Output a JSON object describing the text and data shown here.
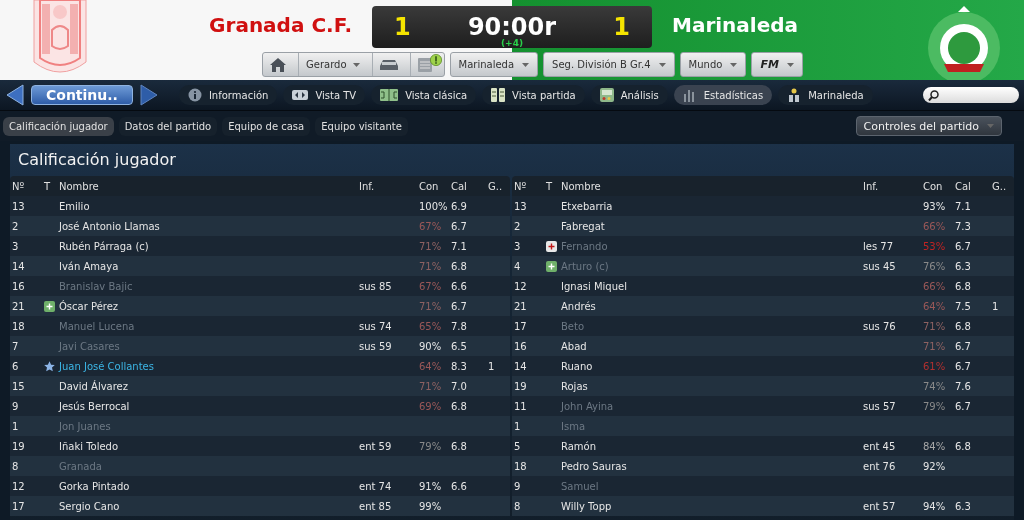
{
  "match": {
    "home": {
      "name": "Granada C.F.",
      "score": "1"
    },
    "away": {
      "name": "Marinaleda",
      "score": "1"
    },
    "clock": "90:00r",
    "added_time": "(+4)"
  },
  "toolbar": {
    "manager": "Gerardo",
    "alert": true,
    "dropdowns": [
      "Marinaleda",
      "Seg. División B Gr.4",
      "Mundo"
    ],
    "logo": "FM"
  },
  "nav": {
    "continue": "Continu..",
    "tabs": [
      {
        "label": "Información",
        "kind": "info",
        "selected": false
      },
      {
        "label": "Vista TV",
        "kind": "tv",
        "selected": false
      },
      {
        "label": "Vista clásica",
        "kind": "pitch",
        "selected": false
      },
      {
        "label": "Vista partida",
        "kind": "split",
        "selected": false
      },
      {
        "label": "Análisis",
        "kind": "analysis",
        "selected": false
      },
      {
        "label": "Estadísticas",
        "kind": "stats",
        "selected": true
      },
      {
        "label": "Marinaleda",
        "kind": "team",
        "selected": false
      }
    ]
  },
  "subtabs": [
    {
      "label": "Calificación jugador",
      "selected": true
    },
    {
      "label": "Datos del partido",
      "selected": false
    },
    {
      "label": "Equipo de casa",
      "selected": false
    },
    {
      "label": "Equipo visitante",
      "selected": false
    }
  ],
  "controls": "Controles del partido",
  "panel_title": "Calificación jugador",
  "tables": [
    {
      "columns": [
        "Nº",
        "T",
        "Nombre",
        "Inf.",
        "Con",
        "Cal",
        "G.."
      ],
      "rows": [
        {
          "no": "13",
          "name": "Emilio",
          "dimmed": false,
          "con": {
            "text": "100%",
            "color": "#e6e6e6"
          },
          "cal": "6.9"
        },
        {
          "no": "2",
          "name": "José Antonio Llamas",
          "dimmed": false,
          "con": {
            "text": "67%",
            "color": "#9a5858"
          },
          "cal": "6.7"
        },
        {
          "no": "3",
          "name": "Rubén Párraga (c)",
          "dimmed": false,
          "con": {
            "text": "71%",
            "color": "#8e6262"
          },
          "cal": "7.1"
        },
        {
          "no": "14",
          "name": "Iván Amaya",
          "dimmed": false,
          "con": {
            "text": "71%",
            "color": "#8e6262"
          },
          "cal": "6.8"
        },
        {
          "no": "16",
          "name": "Branislav Bajic",
          "dimmed": true,
          "inf": "sus 85",
          "con": {
            "text": "67%",
            "color": "#9a5858"
          },
          "cal": "6.6"
        },
        {
          "no": "21",
          "kind": "sub",
          "name": "Óscar Pérez",
          "dimmed": false,
          "con": {
            "text": "71%",
            "color": "#8e6262"
          },
          "cal": "6.7"
        },
        {
          "no": "18",
          "name": "Manuel Lucena",
          "dimmed": true,
          "inf": "sus 74",
          "con": {
            "text": "65%",
            "color": "#9a5858"
          },
          "cal": "7.8"
        },
        {
          "no": "7",
          "name": "Javi Casares",
          "dimmed": true,
          "inf": "sus 59",
          "con": {
            "text": "90%",
            "color": "#e6e6e6"
          },
          "cal": "6.5"
        },
        {
          "no": "6",
          "kind": "star",
          "name": "Juan José Collantes",
          "dimmed": false,
          "highlighted": true,
          "con": {
            "text": "64%",
            "color": "#9a5858"
          },
          "cal": "8.3",
          "goals": "1"
        },
        {
          "no": "15",
          "name": "David Álvarez",
          "dimmed": false,
          "con": {
            "text": "71%",
            "color": "#8e6262"
          },
          "cal": "7.0"
        },
        {
          "no": "9",
          "name": "Jesús Berrocal",
          "dimmed": false,
          "con": {
            "text": "69%",
            "color": "#9a5858"
          },
          "cal": "6.8"
        },
        {
          "no": "1",
          "name": "Jon Juanes",
          "dimmed": true
        },
        {
          "no": "19",
          "name": "Iñaki Toledo",
          "dimmed": false,
          "inf": "ent 59",
          "con": {
            "text": "79%",
            "color": "#8a8a8a"
          },
          "cal": "6.8"
        },
        {
          "no": "8",
          "name": "Granada",
          "dimmed": true
        },
        {
          "no": "12",
          "name": "Gorka Pintado",
          "dimmed": false,
          "inf": "ent 74",
          "con": {
            "text": "91%",
            "color": "#e6e6e6"
          },
          "cal": "6.6"
        },
        {
          "no": "17",
          "name": "Sergio Cano",
          "dimmed": false,
          "inf": "ent 85",
          "con": {
            "text": "99%",
            "color": "#e6e6e6"
          }
        }
      ]
    },
    {
      "columns": [
        "Nº",
        "T",
        "Nombre",
        "Inf.",
        "Con",
        "Cal",
        "G.."
      ],
      "rows": [
        {
          "no": "13",
          "name": "Etxebarria",
          "dimmed": false,
          "con": {
            "text": "93%",
            "color": "#e6e6e6"
          },
          "cal": "7.1"
        },
        {
          "no": "2",
          "name": "Fabregat",
          "dimmed": false,
          "con": {
            "text": "66%",
            "color": "#9a5858"
          },
          "cal": "7.3"
        },
        {
          "no": "3",
          "kind": "injury",
          "name": "Fernando",
          "dimmed": true,
          "inf": "les 77",
          "con": {
            "text": "53%",
            "color": "#c02424"
          },
          "cal": "6.7"
        },
        {
          "no": "4",
          "kind": "sub",
          "name": "Arturo (c)",
          "dimmed": true,
          "inf": "sus 45",
          "con": {
            "text": "76%",
            "color": "#8a8a8a"
          },
          "cal": "6.3"
        },
        {
          "no": "12",
          "name": "Ignasi Miquel",
          "dimmed": false,
          "con": {
            "text": "66%",
            "color": "#9a5858"
          },
          "cal": "6.8"
        },
        {
          "no": "21",
          "name": "Andrés",
          "dimmed": false,
          "con": {
            "text": "64%",
            "color": "#9a5858"
          },
          "cal": "7.5",
          "goals": "1"
        },
        {
          "no": "17",
          "name": "Beto",
          "dimmed": true,
          "inf": "sus 76",
          "con": {
            "text": "71%",
            "color": "#8e6262"
          },
          "cal": "6.8"
        },
        {
          "no": "16",
          "name": "Abad",
          "dimmed": false,
          "con": {
            "text": "71%",
            "color": "#8e6262"
          },
          "cal": "6.7"
        },
        {
          "no": "14",
          "name": "Ruano",
          "dimmed": false,
          "con": {
            "text": "61%",
            "color": "#b03030"
          },
          "cal": "6.7"
        },
        {
          "no": "19",
          "name": "Rojas",
          "dimmed": false,
          "con": {
            "text": "74%",
            "color": "#8a8a8a"
          },
          "cal": "7.6"
        },
        {
          "no": "11",
          "name": "John Ayina",
          "dimmed": true,
          "inf": "sus 57",
          "con": {
            "text": "79%",
            "color": "#8a8a8a"
          },
          "cal": "6.7"
        },
        {
          "no": "1",
          "name": "Isma",
          "dimmed": true
        },
        {
          "no": "5",
          "name": "Ramón",
          "dimmed": false,
          "inf": "ent 45",
          "con": {
            "text": "84%",
            "color": "#a8a8a8"
          },
          "cal": "6.8"
        },
        {
          "no": "18",
          "name": "Pedro Sauras",
          "dimmed": false,
          "inf": "ent 76",
          "con": {
            "text": "92%",
            "color": "#e6e6e6"
          }
        },
        {
          "no": "9",
          "name": "Samuel",
          "dimmed": true
        },
        {
          "no": "8",
          "name": "Willy Topp",
          "dimmed": false,
          "inf": "ent 57",
          "con": {
            "text": "94%",
            "color": "#e6e6e6"
          },
          "cal": "6.3"
        }
      ]
    }
  ]
}
